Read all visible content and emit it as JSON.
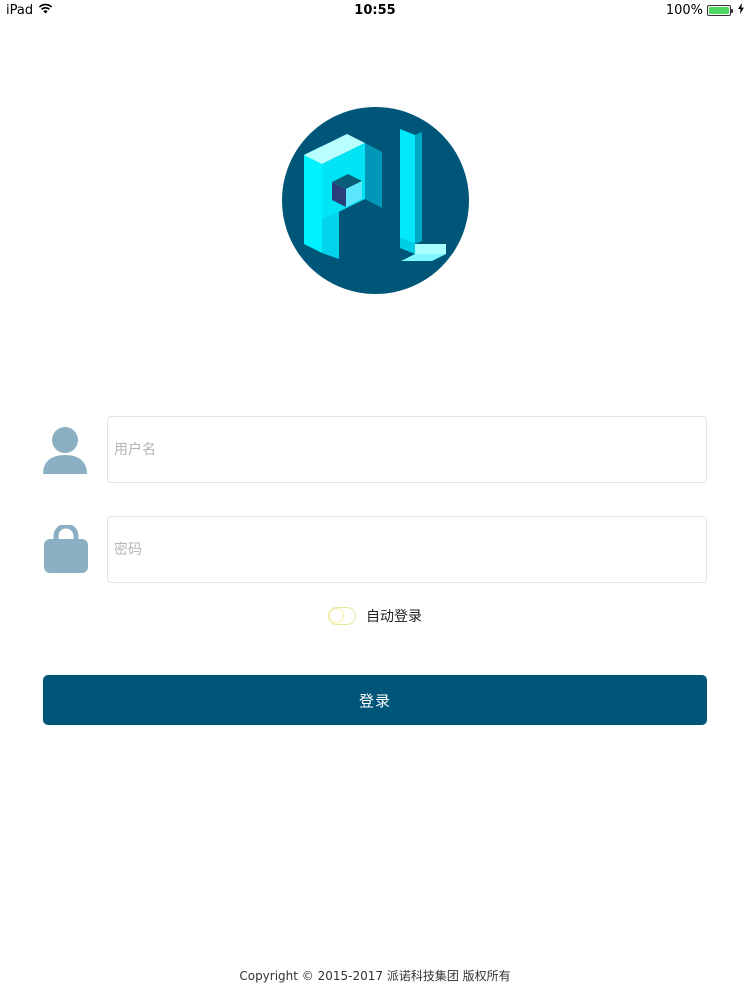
{
  "status_bar": {
    "device": "iPad",
    "time": "10:55",
    "battery": "100%",
    "wifi_icon": "wifi-icon",
    "battery_icon": "battery-icon",
    "charging_icon": "charging-bolt-icon"
  },
  "logo": {
    "icon": "pl-logo",
    "bg_color": "#005679",
    "accent_color": "#00f5ff"
  },
  "login_form": {
    "username_placeholder": "用户名",
    "username_value": "",
    "password_placeholder": "密码",
    "password_value": "",
    "user_icon": "user-icon",
    "lock_icon": "lock-icon",
    "auto_login_label": "自动登录",
    "auto_login_checked": false,
    "submit_label": "登录",
    "button_color": "#005679",
    "icon_color": "#8bb0c3"
  },
  "footer": {
    "copyright": "Copyright © 2015-2017 派诺科技集团 版权所有"
  }
}
